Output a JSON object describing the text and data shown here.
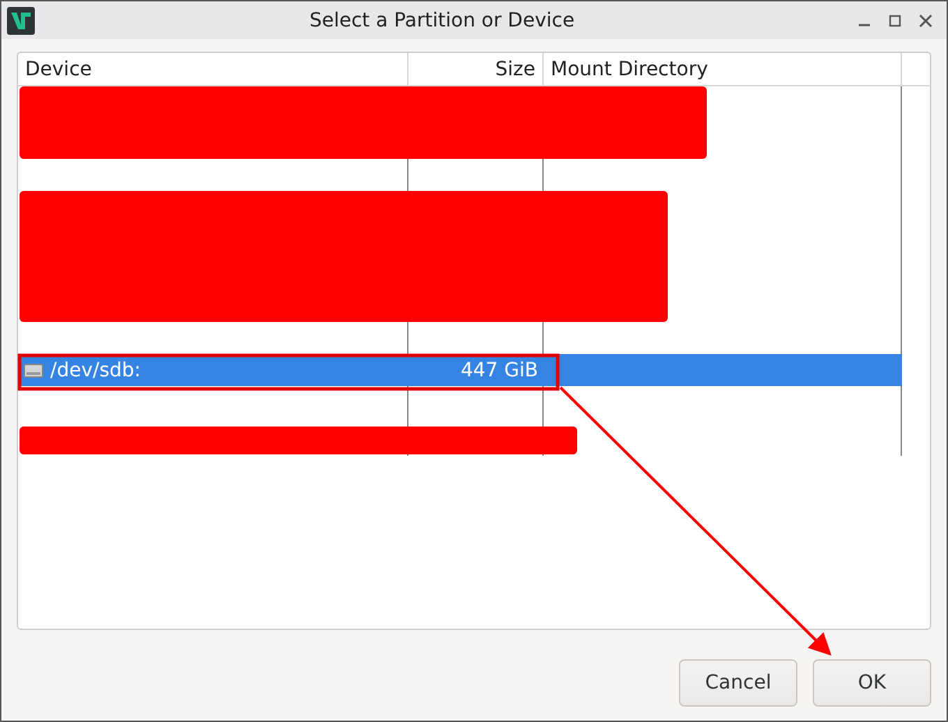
{
  "window": {
    "title": "Select a Partition or Device"
  },
  "table": {
    "columns": [
      "Device",
      "Size",
      "Mount Directory"
    ],
    "rows": [
      {
        "kind": "redacted"
      },
      {
        "kind": "redacted"
      },
      {
        "kind": "device",
        "device": "/dev/sdb:",
        "size": "447 GiB",
        "mount": "",
        "selected": true
      },
      {
        "kind": "redacted"
      }
    ]
  },
  "buttons": [
    "Cancel",
    "OK"
  ]
}
